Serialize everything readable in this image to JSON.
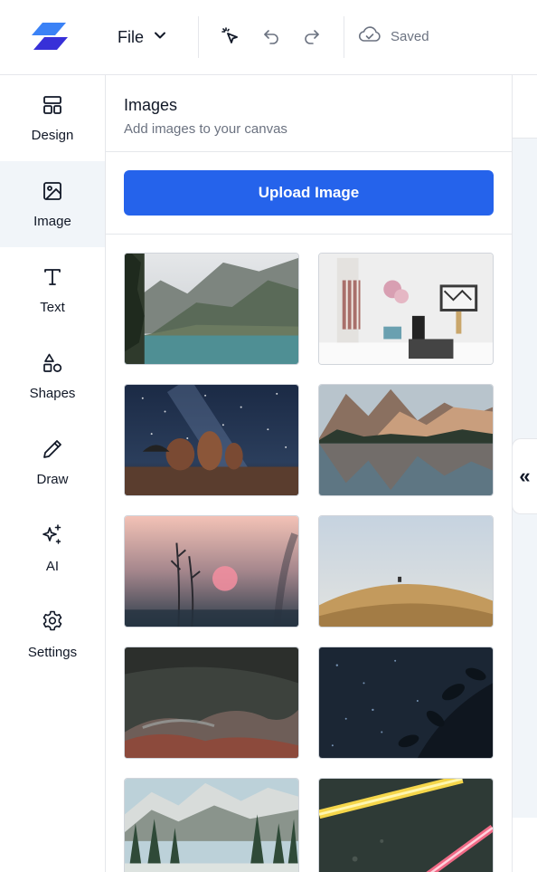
{
  "topbar": {
    "logo": "app-logo",
    "file_label": "File",
    "saved_label": "Saved",
    "icons": [
      "select-cursor-icon",
      "undo-icon",
      "redo-icon",
      "cloud-check-icon"
    ]
  },
  "rail": {
    "items": [
      {
        "label": "Design",
        "icon": "layout-icon"
      },
      {
        "label": "Image",
        "icon": "image-icon",
        "active": true
      },
      {
        "label": "Text",
        "icon": "text-icon"
      },
      {
        "label": "Shapes",
        "icon": "shapes-icon"
      },
      {
        "label": "Draw",
        "icon": "pencil-icon"
      },
      {
        "label": "AI",
        "icon": "sparkles-icon"
      },
      {
        "label": "Settings",
        "icon": "gear-icon"
      }
    ]
  },
  "panel": {
    "title": "Images",
    "subtitle": "Add images to your canvas",
    "upload_label": "Upload Image"
  },
  "collapse": {
    "glyph": "«"
  },
  "colors": {
    "accent": "#2563eb",
    "logo": "#3b4fe4",
    "rail_active_bg": "#f1f5f9"
  }
}
